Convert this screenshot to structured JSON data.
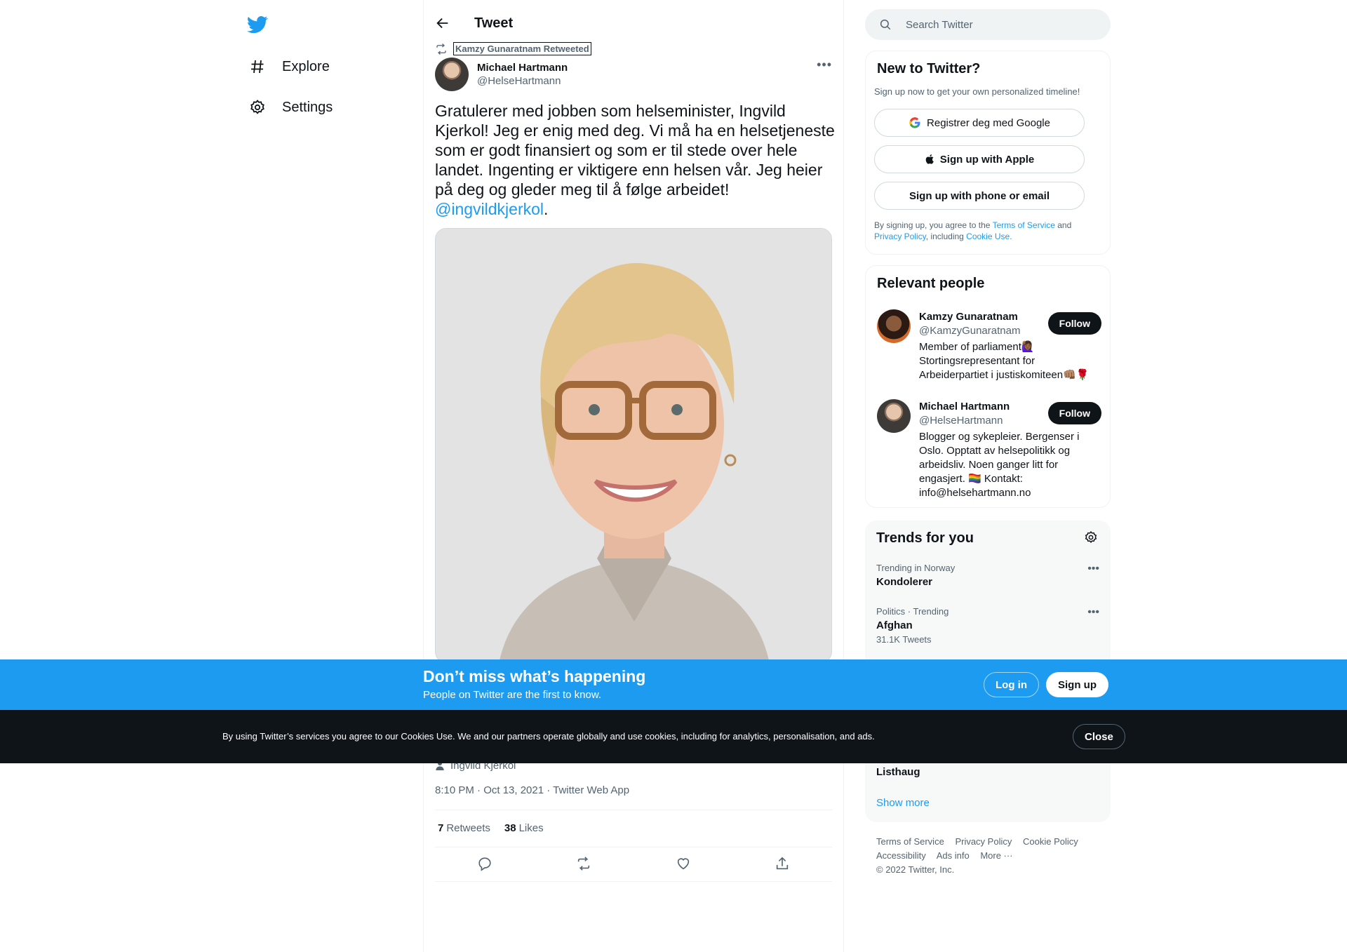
{
  "colors": {
    "accent": "#1d9bf0",
    "text": "#0f1419",
    "muted": "#536471",
    "dark": "#0f1419"
  },
  "nav": {
    "logo_icon": "twitter-bird-icon",
    "items": [
      {
        "label": "Explore",
        "icon": "hashtag-icon"
      },
      {
        "label": "Settings",
        "icon": "gear-icon"
      }
    ]
  },
  "header": {
    "title": "Tweet"
  },
  "tweet": {
    "retweeted_by": "Kamzy Gunaratnam Retweeted",
    "author_name": "Michael Hartmann",
    "author_handle": "@HelseHartmann",
    "text": "Gratulerer med jobben som helseminister, Ingvild Kjerkol! Jeg er enig med deg. Vi må ha en helsetjeneste som er godt finansiert og som er til stede over hele landet. Ingenting er viktigere enn helsen vår. Jeg heier på deg og gleder meg til å følge arbeidet! ",
    "mention": "@ingvildkjerkol",
    "text_end": ".",
    "tagged_person": "Ingvild Kjerkol",
    "timestamp": "8:10 PM · Oct 13, 2021 · Twitter Web App",
    "retweets_count": "7",
    "retweets_label": "Retweets",
    "likes_count": "38",
    "likes_label": "Likes"
  },
  "search": {
    "placeholder": "Search Twitter"
  },
  "new_to_twitter": {
    "title": "New to Twitter?",
    "subtitle": "Sign up now to get your own personalized timeline!",
    "google_label": "Registrer deg med Google",
    "apple_label": "Sign up with Apple",
    "phone_label": "Sign up with phone or email",
    "legal_prefix": "By signing up, you agree to the ",
    "terms_link": "Terms of Service",
    "legal_and": " and ",
    "privacy_link": "Privacy Policy",
    "legal_including": ", including ",
    "cookie_link": "Cookie Use."
  },
  "relevant_people": {
    "title": "Relevant people",
    "people": [
      {
        "name": "Kamzy Gunaratnam",
        "handle": "@KamzyGunaratnam",
        "bio": "Member of parliament🙋🏾‍♀️ Stortingsrepresentant for Arbeiderpartiet i justiskomiteen👊🏽🌹",
        "follow_label": "Follow"
      },
      {
        "name": "Michael Hartmann",
        "handle": "@HelseHartmann",
        "bio": "Blogger og sykepleier. Bergenser i Oslo. Opptatt av helsepolitikk og arbeidsliv. Noen ganger litt for engasjert. 🏳️‍🌈 Kontakt: info@helsehartmann.no",
        "follow_label": "Follow"
      }
    ]
  },
  "trends": {
    "title": "Trends for you",
    "items": [
      {
        "meta": "Trending in Norway",
        "name": "Kondolerer",
        "count": ""
      },
      {
        "meta": "Politics · Trending",
        "name": "Afghan",
        "count": "31.1K Tweets"
      },
      {
        "meta": "",
        "name": "Listhaug",
        "count": ""
      }
    ],
    "show_more": "Show more"
  },
  "footer": {
    "links": [
      "Terms of Service",
      "Privacy Policy",
      "Cookie Policy",
      "Accessibility",
      "Ads info",
      "More ···"
    ],
    "copyright": "© 2022 Twitter, Inc."
  },
  "banner": {
    "title": "Don’t miss what’s happening",
    "subtitle": "People on Twitter are the first to know.",
    "login_label": "Log in",
    "signup_label": "Sign up"
  },
  "cookie": {
    "text": "By using Twitter’s services you agree to our Cookies Use. We and our partners operate globally and use cookies, including for analytics, personalisation, and ads.",
    "close_label": "Close"
  }
}
